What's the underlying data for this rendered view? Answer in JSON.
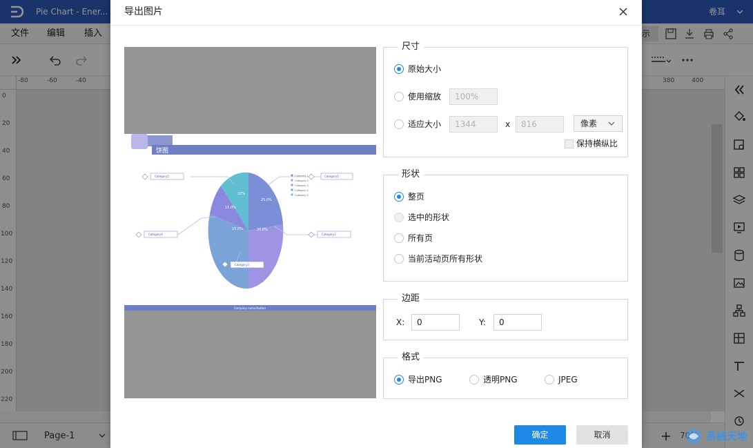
{
  "window": {
    "doc_tab": "Pie Chart - Ener...",
    "user": "卷耳"
  },
  "menu": {
    "items": [
      "文件",
      "编辑",
      "插入"
    ],
    "present_fragment": "示"
  },
  "ruler": {
    "h_labels": [
      "-80",
      "-60",
      "-40",
      "380",
      "400"
    ],
    "v_labels": [
      "0",
      "20",
      "40",
      "60",
      "80",
      "100",
      "120",
      "140",
      "160",
      "180",
      "200",
      "220"
    ]
  },
  "bottom": {
    "page_tab": "Page-1",
    "zoom": "70%"
  },
  "dialog": {
    "title": "导出图片",
    "size": {
      "title": "尺寸",
      "original": "原始大小",
      "scale": "使用缩放",
      "scale_value": "100%",
      "fit": "适应大小",
      "width": "1344",
      "x_sep": "x",
      "height": "816",
      "unit": "像素",
      "keep_ratio": "保持横纵比"
    },
    "shape": {
      "title": "形状",
      "full_page": "整页",
      "selected": "选中的形状",
      "all_pages": "所有页",
      "current_page_all": "当前活动页所有形状"
    },
    "margin": {
      "title": "边距",
      "x_label": "X:",
      "x_value": "0",
      "y_label": "Y:",
      "y_value": "0"
    },
    "format": {
      "title": "格式",
      "png": "导出PNG",
      "transparent_png": "透明PNG",
      "jpeg": "JPEG"
    },
    "ok": "确定",
    "cancel": "取消"
  },
  "preview": {
    "header_title": "饼图",
    "footer": "Company name/Author",
    "legend": [
      "Category 1",
      "Category 2",
      "Category 3",
      "Category 4",
      "Category 5"
    ],
    "callouts": [
      "Category5",
      "Category1",
      "Category4",
      "Category2",
      "Category3"
    ],
    "slice_labels": [
      "25.0%",
      "20.0%",
      "15.0%",
      "15.0%",
      "10%"
    ]
  },
  "watermark": {
    "text": "系统天地"
  },
  "colors": {
    "titlebar": "#2b58b8",
    "accent": "#1e88e5",
    "pie": [
      "#7b8fd6",
      "#9f94e3",
      "#7aa3d8",
      "#8a88e0",
      "#5fbfd0"
    ]
  }
}
